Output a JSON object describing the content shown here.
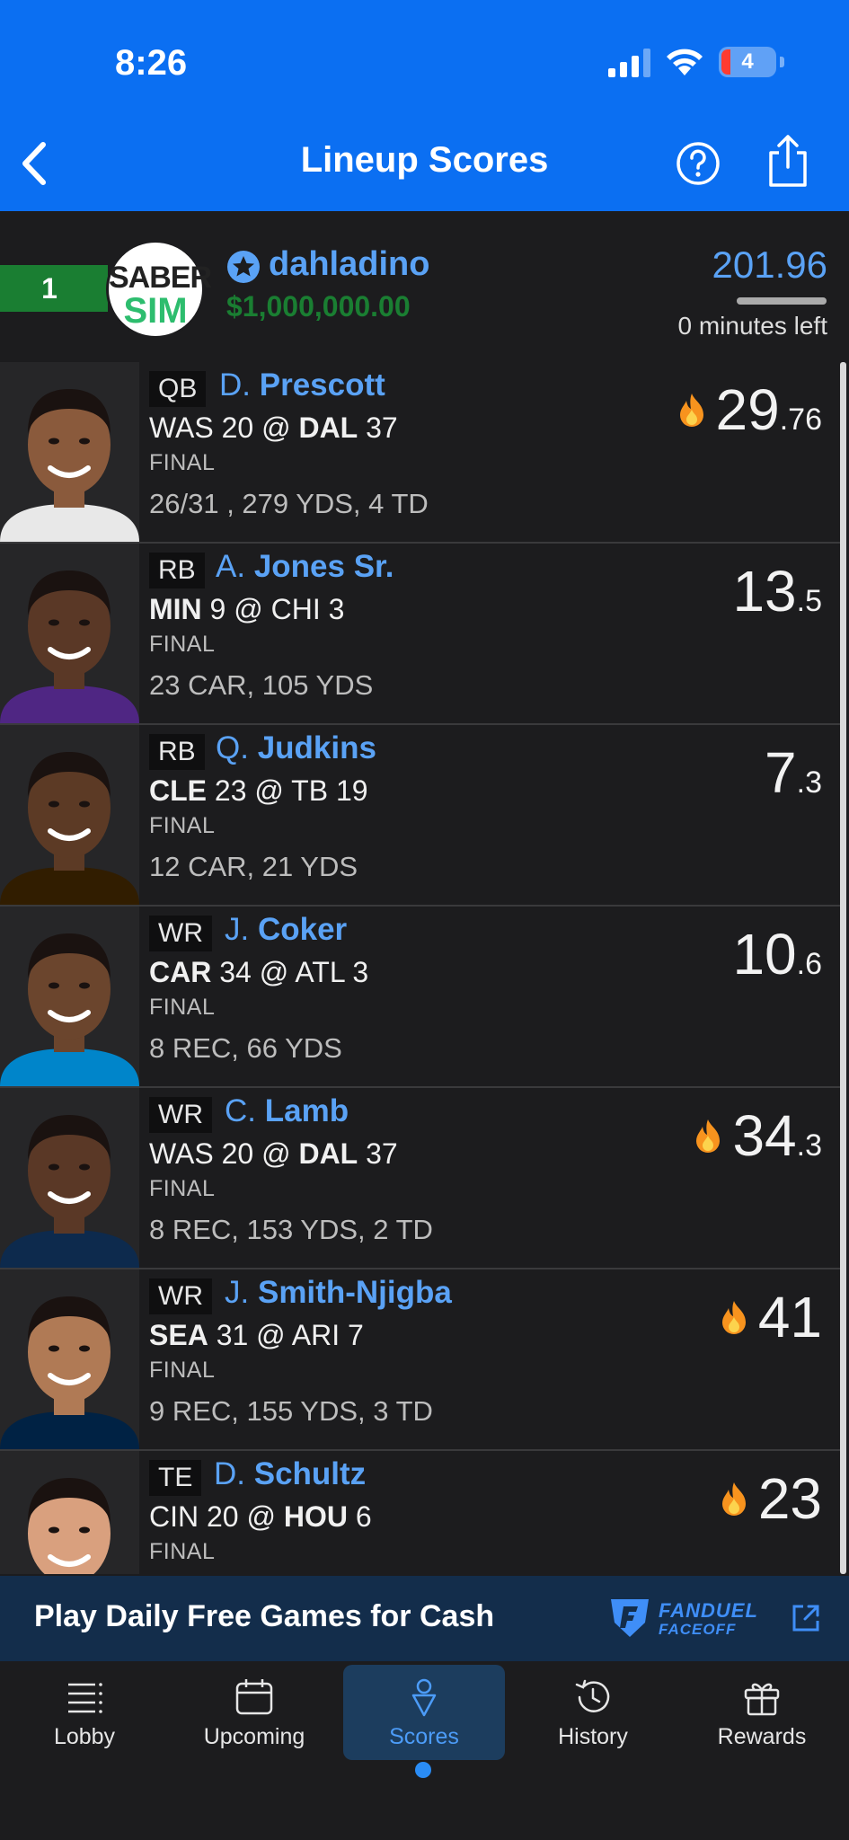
{
  "status_bar": {
    "time": "8:26",
    "battery": "4"
  },
  "nav": {
    "title": "Lineup Scores"
  },
  "summary": {
    "rank": "1",
    "avatar_top": "SABER",
    "avatar_bottom": "SIM",
    "username": "dahladino",
    "prize": "$1,000,000.00",
    "total_score": "201.96",
    "time_left": "0 minutes left",
    "time_progress": 1.0
  },
  "players": [
    {
      "pos": "QB",
      "initial": "D.",
      "name": "Prescott",
      "away": "WAS",
      "away_score": "20",
      "home": "DAL",
      "home_score": "37",
      "bold": "home",
      "status": "FINAL",
      "stats": "26/31 , 279 YDS, 4 TD",
      "score_int": "29",
      "score_dec": ".76",
      "hot": true,
      "skin": "#8a5a3c",
      "jersey": "#e8e8e8"
    },
    {
      "pos": "RB",
      "initial": "A.",
      "name": "Jones Sr.",
      "away": "MIN",
      "away_score": "9",
      "home": "CHI",
      "home_score": "3",
      "bold": "away",
      "status": "FINAL",
      "stats": "23 CAR, 105 YDS",
      "score_int": "13",
      "score_dec": ".5",
      "hot": false,
      "skin": "#5a3826",
      "jersey": "#4f2683"
    },
    {
      "pos": "RB",
      "initial": "Q.",
      "name": "Judkins",
      "away": "CLE",
      "away_score": "23",
      "home": "TB",
      "home_score": "19",
      "bold": "away",
      "status": "FINAL",
      "stats": "12 CAR, 21 YDS",
      "score_int": "7",
      "score_dec": ".3",
      "hot": false,
      "skin": "#5c3a25",
      "jersey": "#311d00"
    },
    {
      "pos": "WR",
      "initial": "J.",
      "name": "Coker",
      "away": "CAR",
      "away_score": "34",
      "home": "ATL",
      "home_score": "3",
      "bold": "away",
      "status": "FINAL",
      "stats": "8 REC, 66 YDS",
      "score_int": "10",
      "score_dec": ".6",
      "hot": false,
      "skin": "#6b452d",
      "jersey": "#0085ca"
    },
    {
      "pos": "WR",
      "initial": "C.",
      "name": "Lamb",
      "away": "WAS",
      "away_score": "20",
      "home": "DAL",
      "home_score": "37",
      "bold": "home",
      "status": "FINAL",
      "stats": "8 REC, 153 YDS, 2 TD",
      "score_int": "34",
      "score_dec": ".3",
      "hot": true,
      "skin": "#5a3826",
      "jersey": "#0d2a4d"
    },
    {
      "pos": "WR",
      "initial": "J.",
      "name": "Smith-Njigba",
      "away": "SEA",
      "away_score": "31",
      "home": "ARI",
      "home_score": "7",
      "bold": "away",
      "status": "FINAL",
      "stats": "9 REC, 155 YDS, 3 TD",
      "score_int": "41",
      "score_dec": "",
      "hot": true,
      "skin": "#b07a55",
      "jersey": "#002244"
    },
    {
      "pos": "TE",
      "initial": "D.",
      "name": "Schultz",
      "away": "CIN",
      "away_score": "20",
      "home": "HOU",
      "home_score": "6",
      "bold": "home",
      "status": "FINAL",
      "stats": "",
      "score_int": "23",
      "score_dec": "",
      "hot": true,
      "skin": "#d9a07e",
      "jersey": "#03202f"
    }
  ],
  "promo": {
    "text": "Play Daily Free Games for Cash",
    "brand_line1": "FANDUEL",
    "brand_line2": "FACEOFF"
  },
  "tabs": [
    {
      "label": "Lobby",
      "icon": "list-icon"
    },
    {
      "label": "Upcoming",
      "icon": "calendar-icon"
    },
    {
      "label": "Scores",
      "icon": "scores-icon",
      "active": true
    },
    {
      "label": "History",
      "icon": "history-icon"
    },
    {
      "label": "Rewards",
      "icon": "gift-icon"
    }
  ],
  "colors": {
    "brand": "#0b6ff2",
    "name_link": "#5aa2f5",
    "prize_green": "#1a7e32",
    "fire": "#f7931e"
  }
}
